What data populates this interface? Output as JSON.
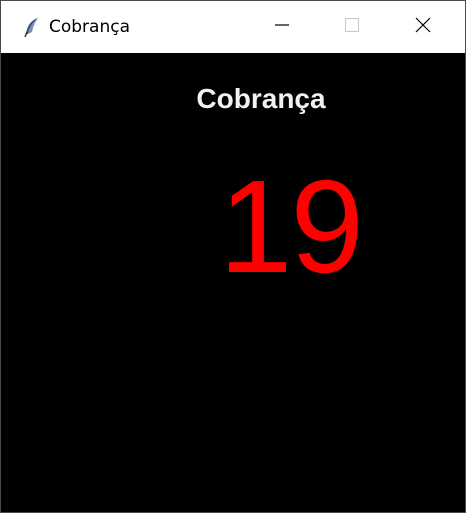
{
  "window": {
    "title": "Cobrança",
    "app_icon": "feather-icon"
  },
  "controls": {
    "minimize_icon": "minimize-icon",
    "maximize_icon": "maximize-icon",
    "close_icon": "close-icon"
  },
  "content": {
    "heading": "Cobrança",
    "counter": "19"
  },
  "colors": {
    "background": "#000000",
    "heading": "#f2f2f2",
    "counter": "#ff0000",
    "titlebar": "#ffffff"
  }
}
